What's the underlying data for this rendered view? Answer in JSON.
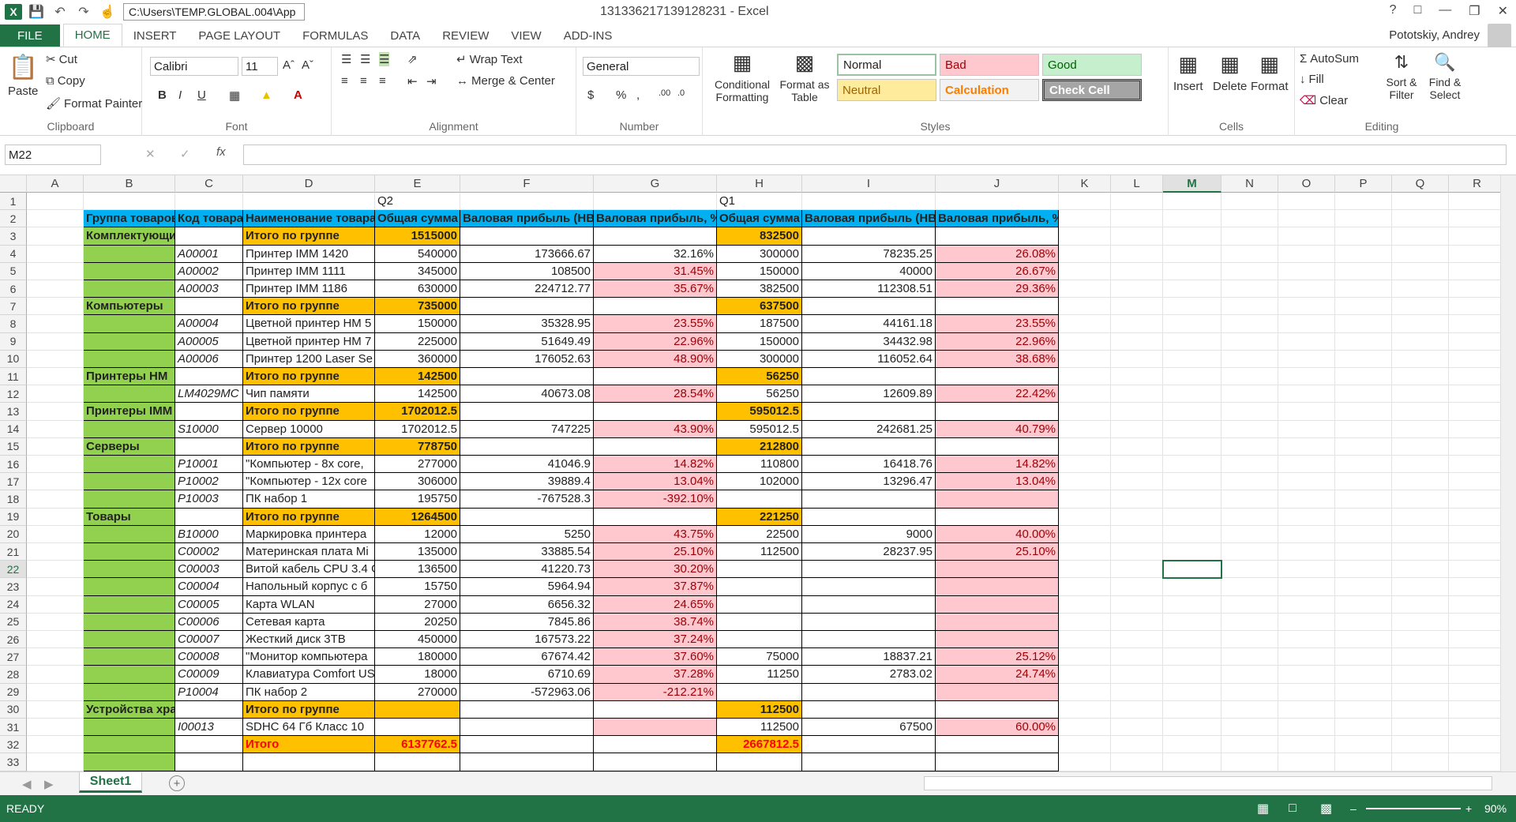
{
  "titlebar": {
    "path": "C:\\Users\\TEMP.GLOBAL.004\\App",
    "title": "131336217139128231 - Excel",
    "help": "?"
  },
  "tabs": [
    "FILE",
    "HOME",
    "INSERT",
    "PAGE LAYOUT",
    "FORMULAS",
    "DATA",
    "REVIEW",
    "VIEW",
    "ADD-INS"
  ],
  "user": "Pototskiy, Andrey",
  "ribbon": {
    "clipboard": {
      "paste": "Paste",
      "cut": "Cut",
      "copy": "Copy",
      "format_painter": "Format Painter",
      "label": "Clipboard"
    },
    "font": {
      "name": "Calibri",
      "size": "11",
      "label": "Font"
    },
    "alignment": {
      "wrap": "Wrap Text",
      "merge": "Merge & Center",
      "label": "Alignment"
    },
    "number": {
      "format": "General",
      "label": "Number"
    },
    "styles": {
      "conditional": "Conditional Formatting",
      "format_table": "Format as Table",
      "normal": "Normal",
      "bad": "Bad",
      "good": "Good",
      "neutral": "Neutral",
      "calculation": "Calculation",
      "check": "Check Cell",
      "label": "Styles"
    },
    "cells": {
      "insert": "Insert",
      "delete": "Delete",
      "format": "Format",
      "label": "Cells"
    },
    "editing": {
      "autosum": "AutoSum",
      "fill": "Fill",
      "clear": "Clear",
      "sort": "Sort & Filter",
      "find": "Find & Select",
      "label": "Editing"
    }
  },
  "namebox": "M22",
  "fx": "fx",
  "columns": [
    "A",
    "B",
    "C",
    "D",
    "E",
    "F",
    "G",
    "H",
    "I",
    "J",
    "K",
    "L",
    "M",
    "N",
    "O",
    "P",
    "Q",
    "R"
  ],
  "rows": [
    [
      "",
      "",
      "",
      "",
      "Q2",
      "",
      "",
      "Q1",
      "",
      ""
    ],
    [
      "",
      "Группа товаров",
      "Код товара",
      "Наименование товара",
      "Общая сумма",
      "Валовая прибыль (НВ)",
      "Валовая прибыль, %",
      "Общая сумма",
      "Валовая прибыль (НВ)",
      "Валовая прибыль, %"
    ],
    [
      "",
      "Комплектующие",
      "",
      "Итого по группе",
      "1515000",
      "",
      "",
      "832500",
      "",
      ""
    ],
    [
      "",
      "",
      "A00001",
      "Принтер IMM 1420",
      "540000",
      "173666.67",
      "32.16%",
      "300000",
      "78235.25",
      "26.08%"
    ],
    [
      "",
      "",
      "A00002",
      "Принтер IMM 1111",
      "345000",
      "108500",
      "31.45%",
      "150000",
      "40000",
      "26.67%"
    ],
    [
      "",
      "",
      "A00003",
      "Принтер IMM 1186",
      "630000",
      "224712.77",
      "35.67%",
      "382500",
      "112308.51",
      "29.36%"
    ],
    [
      "",
      "Компьютеры",
      "",
      "Итого по группе",
      "735000",
      "",
      "",
      "637500",
      "",
      ""
    ],
    [
      "",
      "",
      "A00004",
      "Цветной принтер HM 5",
      "150000",
      "35328.95",
      "23.55%",
      "187500",
      "44161.18",
      "23.55%"
    ],
    [
      "",
      "",
      "A00005",
      "Цветной принтер HM 7",
      "225000",
      "51649.49",
      "22.96%",
      "150000",
      "34432.98",
      "22.96%"
    ],
    [
      "",
      "",
      "A00006",
      "Принтер 1200 Laser Se",
      "360000",
      "176052.63",
      "48.90%",
      "300000",
      "116052.64",
      "38.68%"
    ],
    [
      "",
      "Принтеры HM",
      "",
      "Итого по группе",
      "142500",
      "",
      "",
      "56250",
      "",
      ""
    ],
    [
      "",
      "",
      "LM4029MC",
      "Чип памяти",
      "142500",
      "40673.08",
      "28.54%",
      "56250",
      "12609.89",
      "22.42%"
    ],
    [
      "",
      "Принтеры IMM",
      "",
      "Итого по группе",
      "1702012.5",
      "",
      "",
      "595012.5",
      "",
      ""
    ],
    [
      "",
      "",
      "S10000",
      "Сервер 10000",
      "1702012.5",
      "747225",
      "43.90%",
      "595012.5",
      "242681.25",
      "40.79%"
    ],
    [
      "",
      "Серверы",
      "",
      "Итого по группе",
      "778750",
      "",
      "",
      "212800",
      "",
      ""
    ],
    [
      "",
      "",
      "P10001",
      "\"Компьютер - 8x core, ",
      "277000",
      "41046.9",
      "14.82%",
      "110800",
      "16418.76",
      "14.82%"
    ],
    [
      "",
      "",
      "P10002",
      "\"Компьютер - 12x core",
      "306000",
      "39889.4",
      "13.04%",
      "102000",
      "13296.47",
      "13.04%"
    ],
    [
      "",
      "",
      "P10003",
      "ПК набор 1",
      "195750",
      "-767528.3",
      "-392.10%",
      "",
      "",
      ""
    ],
    [
      "",
      "Товары",
      "",
      "Итого по группе",
      "1264500",
      "",
      "",
      "221250",
      "",
      ""
    ],
    [
      "",
      "",
      "B10000",
      "Маркировка принтера",
      "12000",
      "5250",
      "43.75%",
      "22500",
      "9000",
      "40.00%"
    ],
    [
      "",
      "",
      "C00002",
      "Материнская плата Mi",
      "135000",
      "33885.54",
      "25.10%",
      "112500",
      "28237.95",
      "25.10%"
    ],
    [
      "",
      "",
      "C00003",
      "Витой кабель CPU 3.4 G",
      "136500",
      "41220.73",
      "30.20%",
      "",
      "",
      ""
    ],
    [
      "",
      "",
      "C00004",
      "Напольный корпус с б",
      "15750",
      "5964.94",
      "37.87%",
      "",
      "",
      ""
    ],
    [
      "",
      "",
      "C00005",
      "Карта WLAN",
      "27000",
      "6656.32",
      "24.65%",
      "",
      "",
      ""
    ],
    [
      "",
      "",
      "C00006",
      "Сетевая карта",
      "20250",
      "7845.86",
      "38.74%",
      "",
      "",
      ""
    ],
    [
      "",
      "",
      "C00007",
      "Жесткий диск 3ТВ",
      "450000",
      "167573.22",
      "37.24%",
      "",
      "",
      ""
    ],
    [
      "",
      "",
      "C00008",
      "\"Монитор компьютера",
      "180000",
      "67674.42",
      "37.60%",
      "75000",
      "18837.21",
      "25.12%"
    ],
    [
      "",
      "",
      "C00009",
      "Клавиатура Comfort US",
      "18000",
      "6710.69",
      "37.28%",
      "11250",
      "2783.02",
      "24.74%"
    ],
    [
      "",
      "",
      "P10004",
      "ПК набор 2",
      "270000",
      "-572963.06",
      "-212.21%",
      "",
      "",
      ""
    ],
    [
      "",
      "Устройства хранения",
      "",
      "Итого по группе",
      "",
      "",
      "",
      "112500",
      "",
      ""
    ],
    [
      "",
      "",
      "I00013",
      "SDHC 64 Гб Класс 10",
      "",
      "",
      "",
      "112500",
      "67500",
      "60.00%"
    ],
    [
      "",
      "",
      "",
      "Итого",
      "6137762.5",
      "",
      "",
      "2667812.5",
      "",
      ""
    ],
    [
      "",
      "",
      "",
      "",
      "",
      "",
      "",
      "",
      "",
      ""
    ]
  ],
  "sheet": "Sheet1",
  "status": {
    "ready": "READY",
    "zoom": "90%"
  }
}
